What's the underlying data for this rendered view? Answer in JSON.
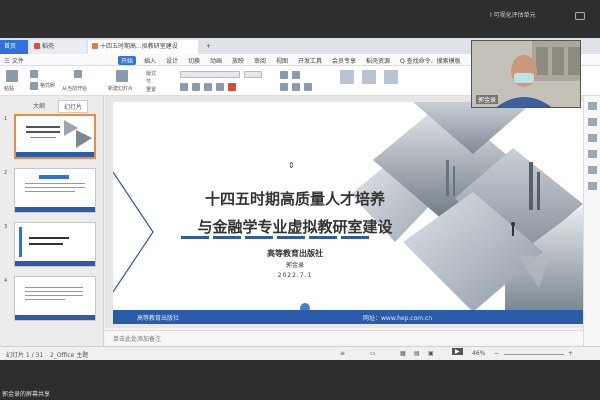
{
  "meeting": {
    "title": "I 可视化评估单元",
    "participant_name": "郭金录",
    "bottom_status": "郭金录的屏幕共享"
  },
  "tabs": [
    {
      "label": "首页"
    },
    {
      "label": "稻壳"
    },
    {
      "label": "十四五时期高...拟教研室建设"
    }
  ],
  "menus": [
    "三 文件",
    "开始",
    "插入",
    "设计",
    "切换",
    "动画",
    "放映",
    "审阅",
    "视图",
    "开发工具",
    "会员专享",
    "稻壳资源",
    "Q 查找命令、搜索模板"
  ],
  "ribbon": {
    "paste": "粘贴",
    "new_slide": "新建幻灯片",
    "layout": "版式",
    "reset": "重置",
    "section": "节",
    "format_brush": "格式刷",
    "from_current": "从当前开始"
  },
  "left_panel": {
    "tab_outline": "大纲",
    "tab_slides": "幻灯片",
    "slide_numbers": [
      "1",
      "2",
      "3",
      "4"
    ]
  },
  "slide": {
    "title_line1": "十四五时期高质量人才培养",
    "title_line2": "与金融学专业虚拟教研室建设",
    "publisher": "高等教育出版社",
    "author": "郭金录",
    "date": "2022.7.1",
    "footer_left": "高等教育出版社",
    "footer_right": "网址：www.hep.com.cn"
  },
  "notes_placeholder": "单击此处添加备注",
  "status": {
    "slide_count": "幻灯片 1 / 31",
    "theme": "2_Office 主题",
    "zoom": "46%"
  },
  "colors": {
    "accent": "#2f72d8",
    "slide_footer": "#2a5ca8",
    "selection": "#f08a3c",
    "underline_blue": "#2a5ca8"
  }
}
